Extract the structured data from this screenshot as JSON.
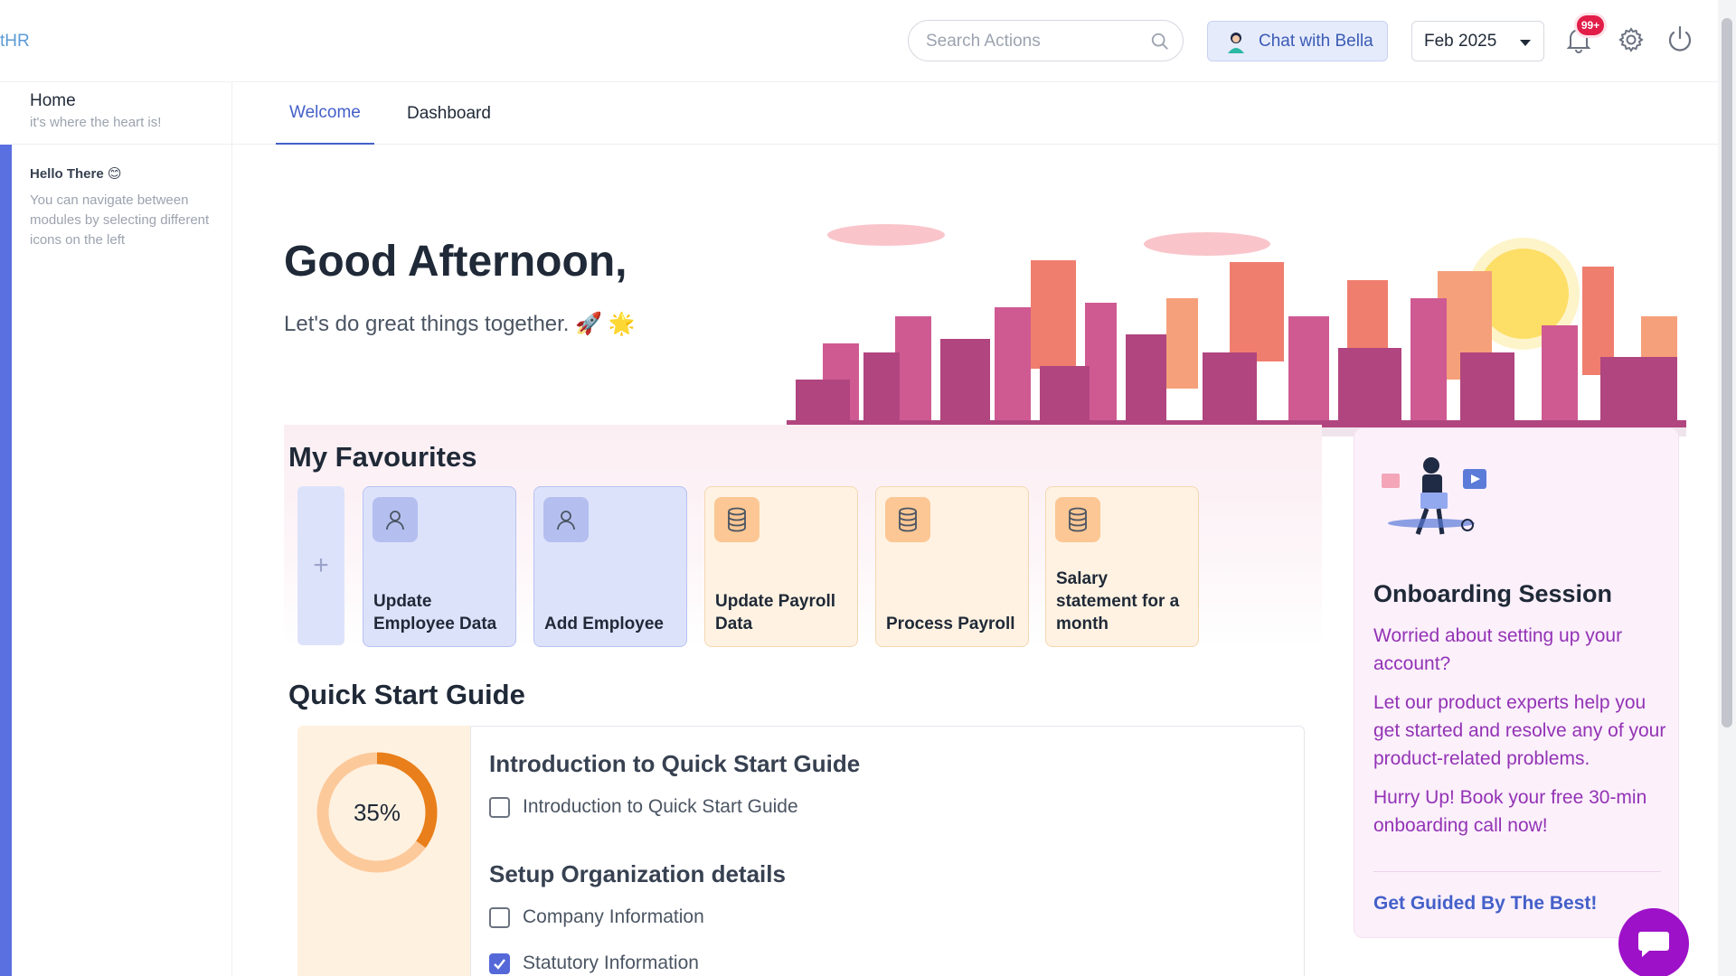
{
  "topbar": {
    "brand": "tHR",
    "search": {
      "placeholder": "Search Actions",
      "value": ""
    },
    "chat_button_label": "Chat with Bella",
    "period": {
      "selected": "Feb 2025"
    },
    "notifications_badge": "99+"
  },
  "sidebar": {
    "home_title": "Home",
    "home_subtitle": "it's where the heart is!",
    "hello_title": "Hello There 😊",
    "hello_text": "You can navigate between modules by selecting different icons on the left"
  },
  "tabs": [
    {
      "label": "Welcome",
      "active": true
    },
    {
      "label": "Dashboard",
      "active": false
    }
  ],
  "welcome": {
    "greeting": "Good Afternoon,",
    "tagline": "Let's do great things together. 🚀 🌟"
  },
  "favourites": {
    "title": "My Favourites",
    "add_label": "+",
    "items": [
      {
        "label": "Update Employee Data",
        "icon": "user-icon",
        "theme": "blue"
      },
      {
        "label": "Add Employee",
        "icon": "user-icon",
        "theme": "blue"
      },
      {
        "label": "Update Payroll Data",
        "icon": "database-icon",
        "theme": "peach"
      },
      {
        "label": "Process Payroll",
        "icon": "database-icon",
        "theme": "peach"
      },
      {
        "label": "Salary statement for a month",
        "icon": "database-icon",
        "theme": "peach"
      }
    ]
  },
  "quick_start": {
    "title": "Quick Start Guide",
    "progress_percent": 35,
    "progress_label": "35%",
    "sections": [
      {
        "heading": "Introduction to Quick Start Guide",
        "items": [
          {
            "label": "Introduction to Quick Start Guide",
            "checked": false
          }
        ]
      },
      {
        "heading": "Setup Organization details",
        "items": [
          {
            "label": "Company Information",
            "checked": false
          },
          {
            "label": "Statutory Information",
            "checked": true
          }
        ]
      }
    ]
  },
  "onboarding": {
    "title": "Onboarding Session",
    "paragraphs": [
      "Worried about setting up your account?",
      "Let our product experts help you get started and resolve any of your product-related problems.",
      "Hurry Up! Book your free 30-min onboarding call now!"
    ],
    "link": "Get Guided By The Best!"
  },
  "colors": {
    "accent": "#4460c9",
    "sidebar_accent": "#5a6fe0",
    "progress": "#e87f1a",
    "fab": "#9d11c8"
  }
}
